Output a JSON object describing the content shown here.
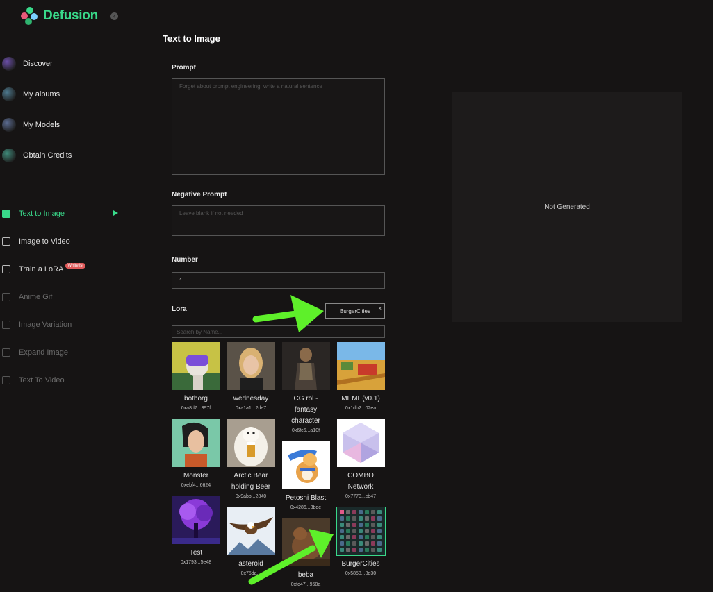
{
  "brand": {
    "name": "Defusion"
  },
  "nav_main": [
    {
      "label": "Discover",
      "color": "#6b4ea8"
    },
    {
      "label": "My albums",
      "color": "#4e7a8f"
    },
    {
      "label": "My Models",
      "color": "#5a6a8f"
    },
    {
      "label": "Obtain Credits",
      "color": "#3f8a7a"
    }
  ],
  "nav_tools": [
    {
      "label": "Text to Image",
      "state": "active"
    },
    {
      "label": "Image to Video",
      "state": "normal"
    },
    {
      "label": "Train a LoRA",
      "state": "normal",
      "badge": "Whitelist"
    },
    {
      "label": "Anime Gif",
      "state": "dim"
    },
    {
      "label": "Image Variation",
      "state": "dim"
    },
    {
      "label": "Expand Image",
      "state": "dim"
    },
    {
      "label": "Text To Video",
      "state": "dim"
    }
  ],
  "form": {
    "title": "Text to Image",
    "prompt_label": "Prompt",
    "prompt_placeholder": "Forget about prompt engineering, write a natural sentence",
    "negative_label": "Negative Prompt",
    "negative_placeholder": "Leave blank if not needed",
    "number_label": "Number",
    "number_value": "1",
    "lora_label": "Lora",
    "lora_selected": "BurgerCities",
    "lora_remove_glyph": "×",
    "search_placeholder": "Search by Name..."
  },
  "lora_grid": [
    {
      "name": "botborg",
      "addr": "0xa8d7...397f",
      "art": "botborg"
    },
    {
      "name": "wednesday",
      "addr": "0xa1a1...2de7",
      "art": "wednesday"
    },
    {
      "name": "CG rol - fantasy character",
      "addr": "0x6fc6...a10f",
      "art": "fantasy"
    },
    {
      "name": "MEME(v0.1)",
      "addr": "0x1db2...02ea",
      "art": "meme"
    },
    {
      "name": "Monster",
      "addr": "0xebf4...6624",
      "art": "monster"
    },
    {
      "name": "Arctic Bear holding Beer",
      "addr": "0x9abb...2840",
      "art": "bear"
    },
    {
      "name": "Petoshi Blast",
      "addr": "0x4286...3bde",
      "art": "dog"
    },
    {
      "name": "COMBO Network",
      "addr": "0x7773...cb47",
      "art": "gem"
    },
    {
      "name": "Test",
      "addr": "0x1793...5e48",
      "art": "tree"
    },
    {
      "name": "asteroid",
      "addr": "0x75da...",
      "art": "eagle"
    },
    {
      "name": "beba",
      "addr": "0xfd47...958a",
      "art": "brownbear"
    },
    {
      "name": "BurgerCities",
      "addr": "0x5858...8d30",
      "art": "grid",
      "selected": true
    }
  ],
  "preview": {
    "status": "Not Generated"
  },
  "colors": {
    "accent": "#39d98a",
    "badge": "#e05a5a",
    "arrow": "#5ef02a"
  }
}
